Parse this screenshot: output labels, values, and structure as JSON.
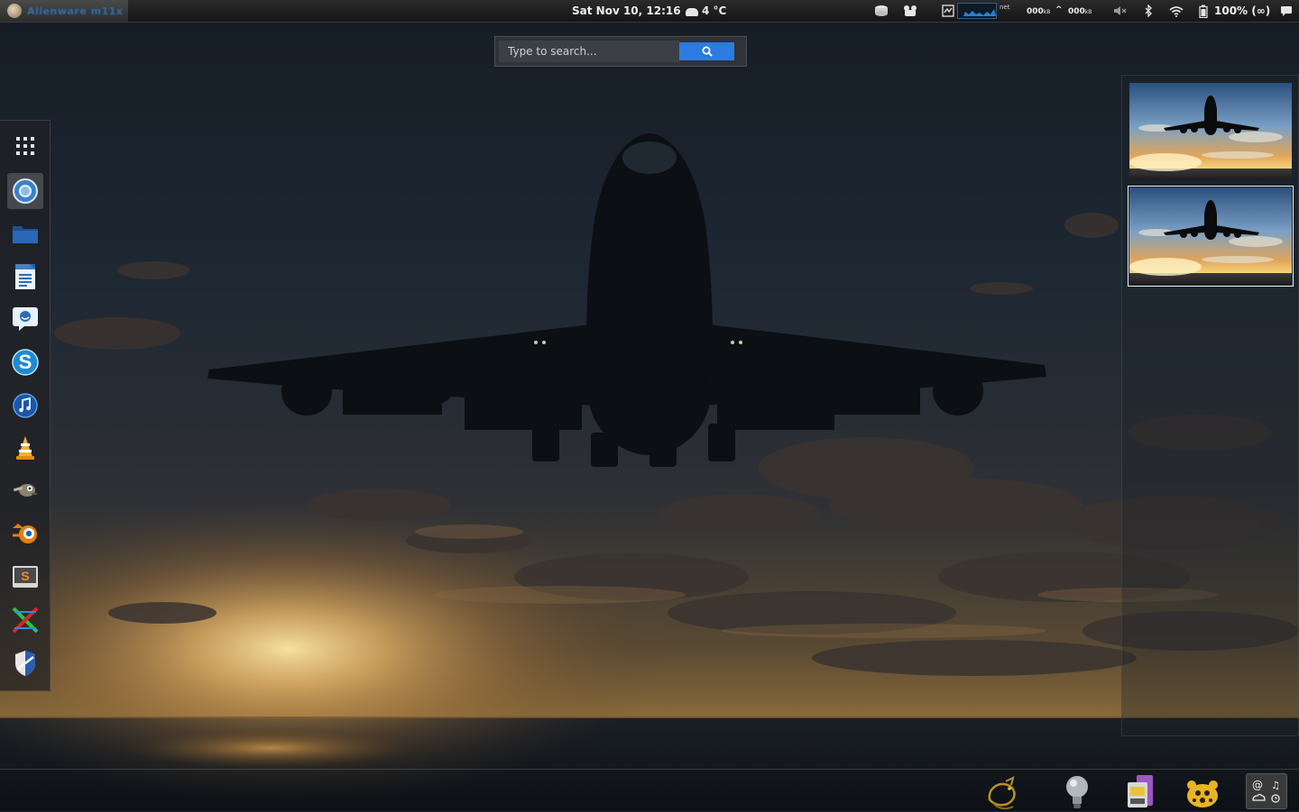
{
  "top_panel": {
    "app_name": "Alienware m11x",
    "datetime": "Sat Nov 10, 12:16",
    "weather_temp": "4 °C",
    "net_label": "net",
    "net_down_value": "000",
    "net_down_unit": "kB",
    "net_up_value": "000",
    "net_up_unit": "kB",
    "battery_text": "100% (∞)",
    "icons": [
      "drive-icon",
      "applet-icon",
      "system-monitor-icon",
      "network-graph-icon",
      "volume-muted-icon",
      "bluetooth-icon",
      "wifi-icon",
      "battery-icon",
      "messages-icon"
    ]
  },
  "search": {
    "placeholder": "Type to search...",
    "button_icon": "search-icon"
  },
  "launcher": {
    "items": [
      {
        "name": "app-grid-icon"
      },
      {
        "name": "chromium-icon",
        "active": true
      },
      {
        "name": "files-icon"
      },
      {
        "name": "text-editor-icon"
      },
      {
        "name": "chat-icon"
      },
      {
        "name": "skype-icon"
      },
      {
        "name": "itunes-icon"
      },
      {
        "name": "vlc-icon"
      },
      {
        "name": "gimp-icon"
      },
      {
        "name": "blender-icon"
      },
      {
        "name": "sublime-text-icon"
      },
      {
        "name": "crossover-icon"
      },
      {
        "name": "shield-icon"
      }
    ]
  },
  "workspaces": {
    "count": 2,
    "active_index": 1
  },
  "bottom_panel": {
    "items": [
      "dragon-icon",
      "lightbulb-icon",
      "sd-card-icon",
      "paw-icon",
      "status-widget-icon"
    ]
  },
  "colors": {
    "accent": "#2d7be0",
    "panel": "#1d1d1d"
  }
}
